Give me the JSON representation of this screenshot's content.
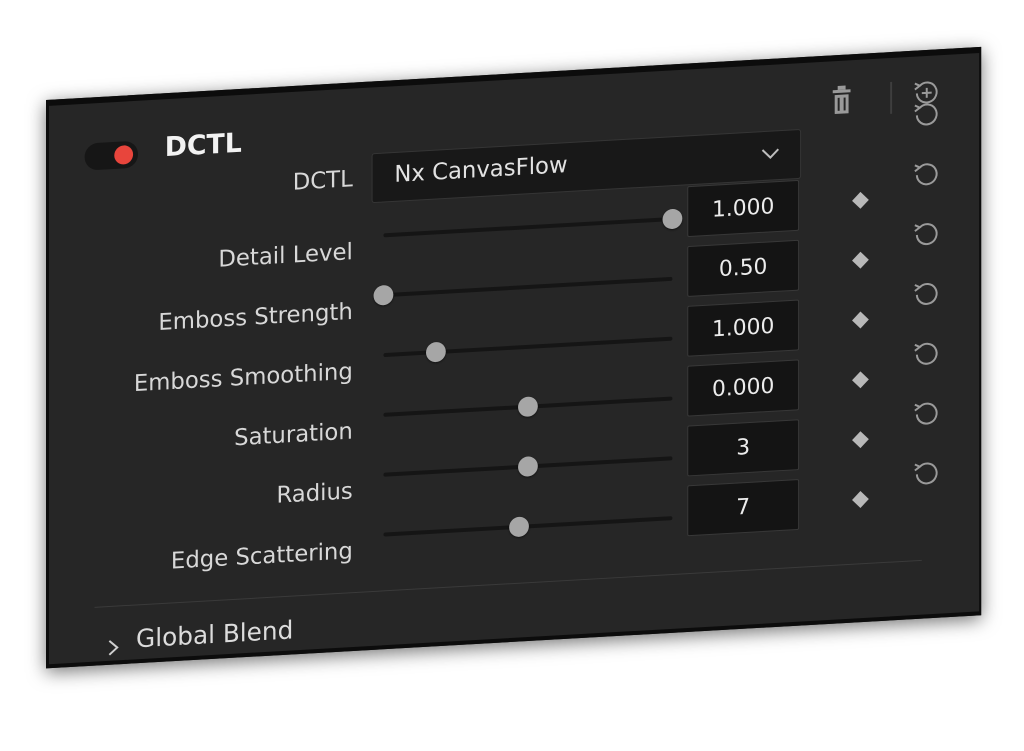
{
  "panel": {
    "title": "DCTL",
    "toggle_on": true,
    "toggle_color": "#e8453c"
  },
  "header_icons": [
    "trash-icon",
    "reset-add-icon"
  ],
  "dropdown": {
    "label": "DCTL",
    "value": "Nx CanvasFlow"
  },
  "params": [
    {
      "label": "Detail Level",
      "value": "1.000",
      "slider_fraction": 1.0
    },
    {
      "label": "Emboss Strength",
      "value": "0.50",
      "slider_fraction": 0.0
    },
    {
      "label": "Emboss Smoothing",
      "value": "1.000",
      "slider_fraction": 0.18
    },
    {
      "label": "Saturation",
      "value": "0.000",
      "slider_fraction": 0.5
    },
    {
      "label": "Radius",
      "value": "3",
      "slider_fraction": 0.5
    },
    {
      "label": "Edge Scattering",
      "value": "7",
      "slider_fraction": 0.47
    }
  ],
  "section": {
    "label": "Global Blend",
    "expanded": false
  }
}
